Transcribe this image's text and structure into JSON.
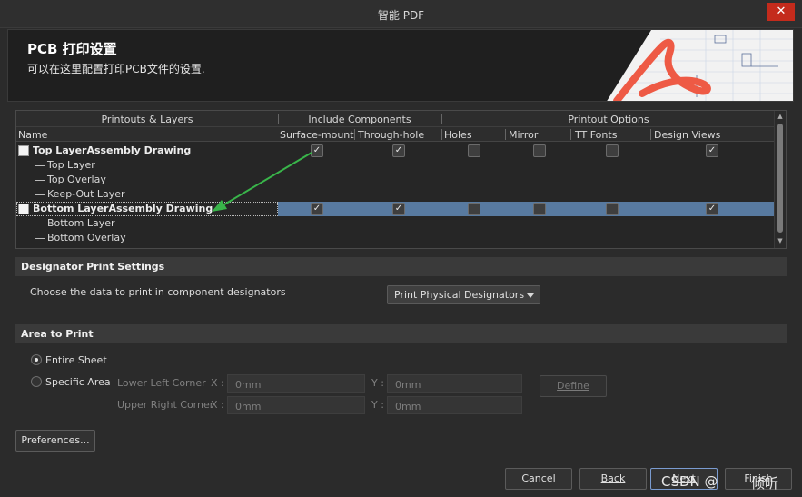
{
  "window": {
    "title": "智能 PDF",
    "close_label": "✕"
  },
  "header": {
    "title": "PCB 打印设置",
    "subtitle": "可以在这里配置打印PCB文件的设置."
  },
  "tree": {
    "groups": [
      "Printouts & Layers",
      "Include Components",
      "Printout Options"
    ],
    "columns": [
      "Name",
      "Surface-mount",
      "Through-hole",
      "Holes",
      "Mirror",
      "TT Fonts",
      "Design Views"
    ],
    "rows": [
      {
        "label": "Top LayerAssembly Drawing",
        "bold": true,
        "child": false,
        "selected": false,
        "checks": [
          true,
          true,
          false,
          false,
          false,
          true
        ]
      },
      {
        "label": "Top Layer",
        "bold": false,
        "child": true
      },
      {
        "label": "Top Overlay",
        "bold": false,
        "child": true
      },
      {
        "label": "Keep-Out Layer",
        "bold": false,
        "child": true
      },
      {
        "label": "Bottom LayerAssembly Drawing",
        "bold": true,
        "child": false,
        "selected": true,
        "checks": [
          true,
          true,
          false,
          false,
          false,
          true
        ]
      },
      {
        "label": "Bottom Layer",
        "bold": false,
        "child": true
      },
      {
        "label": "Bottom Overlay",
        "bold": false,
        "child": true
      }
    ]
  },
  "designator": {
    "section_title": "Designator Print Settings",
    "prompt": "Choose the data to print in component designators",
    "selected": "Print Physical Designators"
  },
  "area": {
    "section_title": "Area to Print",
    "entire_sheet": "Entire Sheet",
    "specific_area": "Specific Area",
    "selected": "entire_sheet",
    "lower_left_label": "Lower Left Corner",
    "upper_right_label": "Upper Right Corner",
    "x_label": "X :",
    "y_label": "Y :",
    "lower_left_x": "0mm",
    "lower_left_y": "0mm",
    "upper_right_x": "0mm",
    "upper_right_y": "0mm",
    "define_label": "Define"
  },
  "buttons": {
    "preferences": "Preferences...",
    "cancel": "Cancel",
    "back": "Back",
    "next": "Next",
    "finish": "Finish"
  },
  "watermark": {
    "left": "CSDN @",
    "right": "倾听"
  },
  "colors": {
    "selection": "#587aa0",
    "arrow": "#39b54a",
    "close": "#c42b1c",
    "logo": "#ee5a45"
  }
}
